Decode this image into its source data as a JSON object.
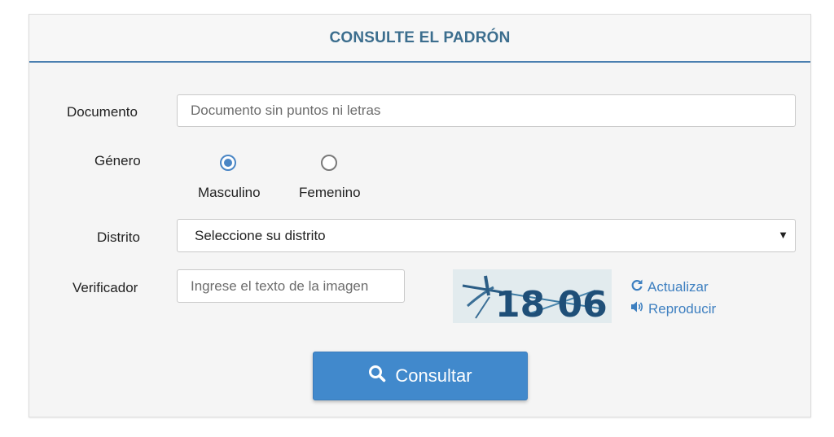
{
  "header": {
    "title": "CONSULTE EL PADRÓN"
  },
  "form": {
    "documento": {
      "label": "Documento",
      "placeholder": "Documento sin puntos ni letras",
      "value": ""
    },
    "genero": {
      "label": "Género",
      "options": [
        {
          "label": "Masculino",
          "checked": true
        },
        {
          "label": "Femenino",
          "checked": false
        }
      ]
    },
    "distrito": {
      "label": "Distrito",
      "selected": "Seleccione su distrito"
    },
    "verificador": {
      "label": "Verificador",
      "placeholder": "Ingrese el texto de la imagen",
      "value": "",
      "captcha_text": "18 06",
      "refresh_label": "Actualizar",
      "audio_label": "Reproducir"
    },
    "submit_label": "Consultar"
  },
  "icons": {
    "search": "search-icon",
    "refresh": "refresh-icon",
    "audio": "volume-icon",
    "dropdown": "caret-down-icon"
  },
  "colors": {
    "accent": "#4189cc",
    "title": "#3c6e8e",
    "link": "#3d7fc0",
    "panel_bg": "#f5f5f5"
  }
}
